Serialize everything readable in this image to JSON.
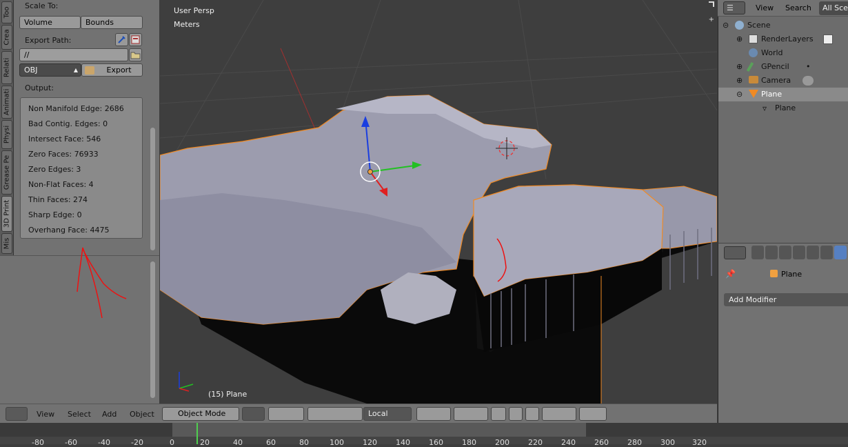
{
  "toolshelf": {
    "tabs": [
      "Too",
      "Crea",
      "Relati",
      "Animati",
      "Physi",
      "Grease Pe",
      "3D Print",
      "Mis"
    ],
    "scale_to_label": "Scale To:",
    "volume_btn": "Volume",
    "bounds_btn": "Bounds",
    "export_path_label": "Export Path:",
    "export_path_value": "//",
    "format_value": "OBJ",
    "export_btn": "Export",
    "output_label": "Output:",
    "output_lines": [
      "Non Manifold Edge: 2686",
      "Bad Contig. Edges: 0",
      "Intersect Face: 546",
      "Zero Faces: 76933",
      "Zero Edges: 3",
      "Non-Flat Faces: 4",
      "Thin Faces: 274",
      "Sharp Edge: 0",
      "Overhang Face: 4475"
    ]
  },
  "viewport": {
    "view_name": "User Persp",
    "units": "Meters",
    "object_label": "(15) Plane"
  },
  "outliner": {
    "menu_view": "View",
    "menu_search": "Search",
    "scene_select": "All Scenes",
    "items": [
      {
        "label": "Scene",
        "icon": "scene-icon"
      },
      {
        "label": "RenderLayers",
        "icon": "render-layers-icon"
      },
      {
        "label": "World",
        "icon": "world-icon"
      },
      {
        "label": "GPencil",
        "icon": "grease-pencil-icon"
      },
      {
        "label": "Camera",
        "icon": "camera-icon"
      },
      {
        "label": "Plane",
        "icon": "mesh-object-icon"
      },
      {
        "label": "Plane",
        "icon": "mesh-data-icon"
      }
    ]
  },
  "properties": {
    "object_name": "Plane",
    "add_modifier": "Add Modifier"
  },
  "header3d": {
    "menus": [
      "View",
      "Select",
      "Add",
      "Object"
    ],
    "mode": "Object Mode",
    "pivot": "Local"
  },
  "timeline": {
    "ticks": [
      "-80",
      "-60",
      "-40",
      "-20",
      "0",
      "20",
      "40",
      "60",
      "80",
      "100",
      "120",
      "140",
      "160",
      "180",
      "200",
      "220",
      "240",
      "260",
      "280",
      "300",
      "320"
    ],
    "current_frame": 15
  },
  "colors": {
    "accent_selected": "#f08a24",
    "axis_x": "#e02020",
    "axis_y": "#22c022",
    "axis_z": "#1a3ee0"
  }
}
